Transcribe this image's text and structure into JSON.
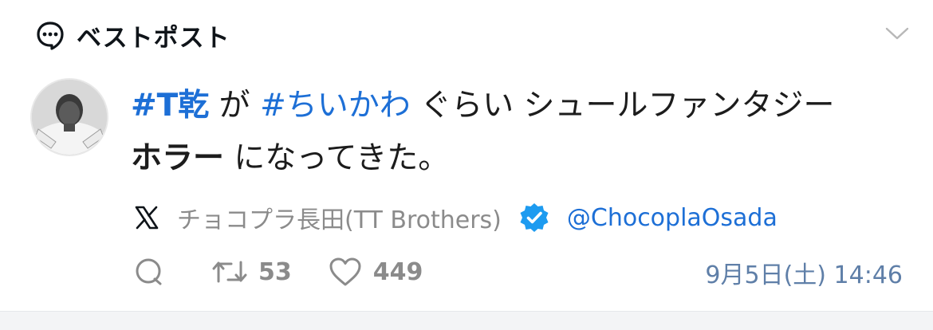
{
  "header": {
    "title": "ベストポスト",
    "icon": "chat-bubble-icon",
    "collapse_icon": "chevron-down-icon"
  },
  "post": {
    "segments": [
      {
        "text": "#T乾",
        "style": "hashtag"
      },
      {
        "text": " が ",
        "style": "plain"
      },
      {
        "text": "#ちいかわ",
        "style": "hashtag-light"
      },
      {
        "text": " ぐらい シュールファンタジー",
        "style": "plain"
      },
      {
        "text": "ホラー",
        "style": "bold"
      },
      {
        "text": " になってきた。",
        "style": "plain"
      }
    ]
  },
  "source": {
    "platform_icon": "x-logo-icon",
    "author_name": "チョコプラ長田(TT Brothers)",
    "verified_icon": "verified-badge-icon",
    "handle": "@ChocoplaOsada"
  },
  "actions": {
    "reply_icon": "reply-icon",
    "repost_icon": "repost-icon",
    "repost_count": "53",
    "like_icon": "heart-icon",
    "like_count": "449"
  },
  "timestamp": "9月5日(土) 14:46",
  "colors": {
    "link": "#1d6fd6",
    "muted": "#8b8b8b",
    "timestamp": "#5f7fa8",
    "verified": "#1d9bf0"
  }
}
